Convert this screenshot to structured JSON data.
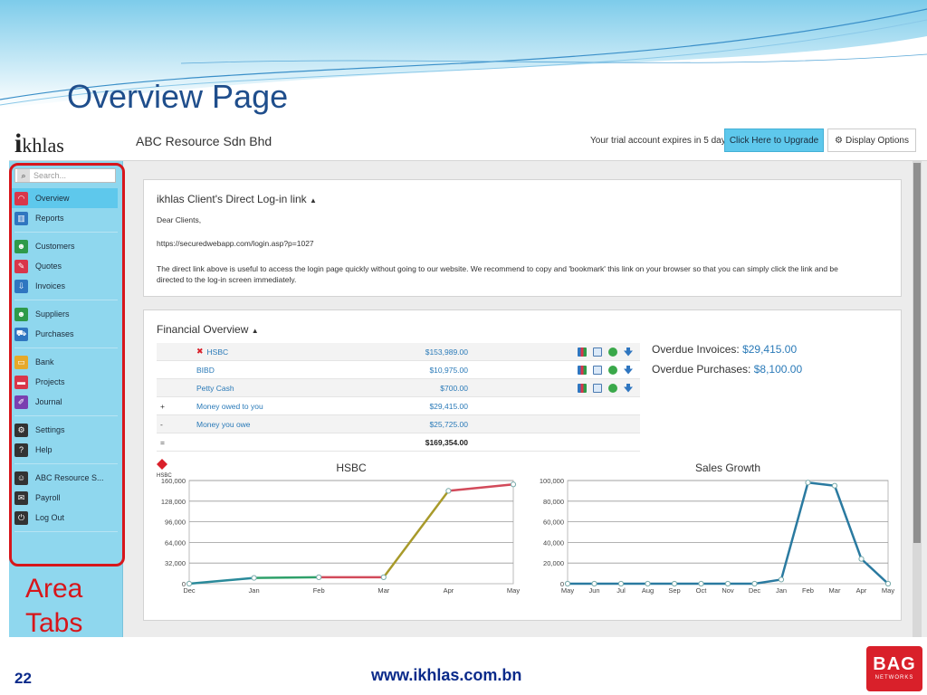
{
  "slide": {
    "title": "Overview Page",
    "footer_url": "www.ikhlas.com.bn",
    "page_number": "22",
    "logo_big": "BAG",
    "logo_small": "NETWORKS",
    "area_label_line1": "Area",
    "area_label_line2": "Tabs"
  },
  "app": {
    "logo_i": "i",
    "logo_rest": "khlas",
    "company": "ABC Resource Sdn Bhd",
    "trial_text": "Your trial account expires in 5 days",
    "upgrade_button": "Click Here to Upgrade",
    "display_options_button": "Display Options"
  },
  "sidebar": {
    "search_placeholder": "Search...",
    "items": [
      {
        "label": "Overview",
        "icon": "gauge-icon",
        "color": "#d9364a"
      },
      {
        "label": "Reports",
        "icon": "bar-chart-icon",
        "color": "#2f76c0"
      },
      {
        "label": "Customers",
        "icon": "users-icon",
        "color": "#2e9a4a"
      },
      {
        "label": "Quotes",
        "icon": "quote-icon",
        "color": "#d9364a"
      },
      {
        "label": "Invoices",
        "icon": "invoice-icon",
        "color": "#2f76c0"
      },
      {
        "label": "Suppliers",
        "icon": "suppliers-icon",
        "color": "#2e9a4a"
      },
      {
        "label": "Purchases",
        "icon": "purchases-icon",
        "color": "#2f76c0"
      },
      {
        "label": "Bank",
        "icon": "bank-icon",
        "color": "#e6a92a"
      },
      {
        "label": "Projects",
        "icon": "folder-icon",
        "color": "#d9364a"
      },
      {
        "label": "Journal",
        "icon": "journal-icon",
        "color": "#7a3fb0"
      },
      {
        "label": "Settings",
        "icon": "gear-icon",
        "color": "#333333"
      },
      {
        "label": "Help",
        "icon": "help-icon",
        "color": "#333333"
      },
      {
        "label": "ABC Resource S...",
        "icon": "user-icon",
        "color": "#333333"
      },
      {
        "label": "Payroll",
        "icon": "payroll-icon",
        "color": "#333333"
      },
      {
        "label": "Log Out",
        "icon": "power-icon",
        "color": "#333333"
      }
    ]
  },
  "login_panel": {
    "title": "ikhlas Client's Direct Log-in link",
    "greeting": "Dear Clients,",
    "url": "https://securedwebapp.com/login.asp?p=1027",
    "note_line1": "The direct link above is useful to access the login page quickly without going to our website. We recommend to copy and 'bookmark' this link on your browser so that you can simply click the link and be",
    "note_line2": "directed to the log-in screen immediately."
  },
  "financial": {
    "title": "Financial Overview",
    "rows": [
      {
        "sign": "",
        "name": "HSBC",
        "amount": "$153,989.00"
      },
      {
        "sign": "",
        "name": "BIBD",
        "amount": "$10,975.00"
      },
      {
        "sign": "",
        "name": "Petty Cash",
        "amount": "$700.00"
      },
      {
        "sign": "+",
        "name": "Money owed to you",
        "amount": "$29,415.00"
      },
      {
        "sign": "-",
        "name": "Money you owe",
        "amount": "$25,725.00"
      },
      {
        "sign": "=",
        "name": "",
        "amount": "$169,354.00"
      }
    ],
    "overdue_invoices_label": "Overdue Invoices:",
    "overdue_invoices_value": "$29,415.00",
    "overdue_purchases_label": "Overdue Purchases:",
    "overdue_purchases_value": "$8,100.00",
    "hsbc_logo_text": "HSBC"
  },
  "chart_data": [
    {
      "type": "line",
      "title": "HSBC",
      "x": [
        "Dec",
        "Jan",
        "Feb",
        "Mar",
        "Apr",
        "May"
      ],
      "values": [
        0,
        9000,
        10000,
        10000,
        144000,
        153989
      ],
      "segment_colors": [
        "#2a8a9a",
        "#2fa06a",
        "#d24a5a",
        "#a89a2a",
        "#d24a5a"
      ],
      "yticks": [
        "0",
        "32,000",
        "64,000",
        "96,000",
        "128,000",
        "160,000"
      ],
      "ylim": [
        0,
        160000
      ],
      "grid": true
    },
    {
      "type": "line",
      "title": "Sales Growth",
      "x": [
        "May",
        "Jun",
        "Jul",
        "Aug",
        "Sep",
        "Oct",
        "Nov",
        "Dec",
        "Jan",
        "Feb",
        "Mar",
        "Apr",
        "May"
      ],
      "values": [
        0,
        0,
        0,
        0,
        0,
        0,
        0,
        0,
        4000,
        98000,
        95000,
        24000,
        0
      ],
      "color": "#2a7aa0",
      "yticks": [
        "0",
        "20,000",
        "40,000",
        "60,000",
        "80,000",
        "100,000"
      ],
      "ylim": [
        0,
        100000
      ],
      "grid": true
    }
  ]
}
